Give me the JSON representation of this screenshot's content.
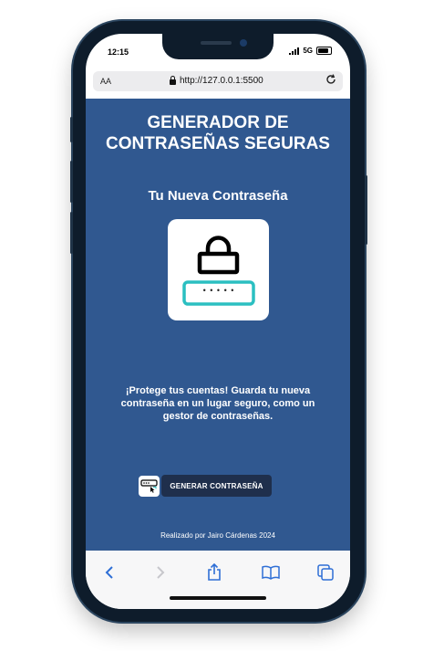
{
  "status_bar": {
    "time": "12:15",
    "network": "5G"
  },
  "browser": {
    "text_size_label": "AA",
    "url": "http://127.0.0.1:5500"
  },
  "page": {
    "title_line1": "GENERADOR DE",
    "title_line2": "CONTRASEÑAS SEGURAS",
    "subtitle": "Tu Nueva Contraseña",
    "password_placeholder": "• • • • •",
    "description": "¡Protege tus cuentas! Guarda tu nueva contraseña en un lugar seguro, como un gestor de contraseñas.",
    "generate_button": "GENERAR CONTRASEÑA",
    "footer": "Realizado por Jairo Cárdenas 2024"
  },
  "colors": {
    "background": "#305890",
    "button": "#1f2f4c",
    "accent_teal": "#2bbfc1"
  },
  "toolbar": {
    "icons": [
      "back-icon",
      "forward-icon",
      "share-icon",
      "bookmarks-icon",
      "tabs-icon"
    ]
  }
}
